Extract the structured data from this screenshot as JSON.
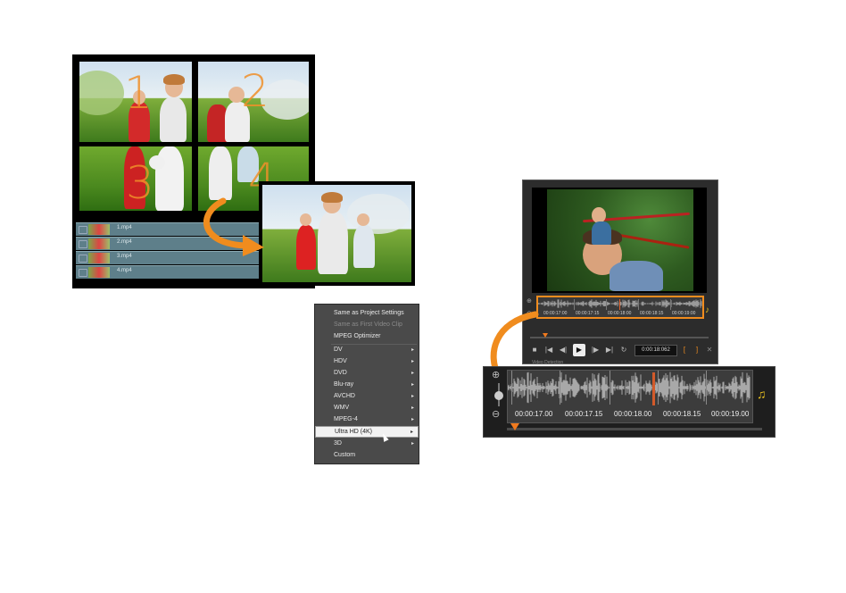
{
  "collage": {
    "quadrant_numbers": [
      "1",
      "2",
      "3",
      "4"
    ],
    "tracks": [
      {
        "name": "1.mp4"
      },
      {
        "name": "2.mp4"
      },
      {
        "name": "3.mp4"
      },
      {
        "name": "4.mp4"
      }
    ]
  },
  "format_menu": {
    "items": [
      {
        "label": "Same as Project Settings",
        "submenu": false,
        "disabled": false
      },
      {
        "label": "Same as First Video Clip",
        "submenu": false,
        "disabled": true
      },
      {
        "label": "MPEG Optimizer",
        "submenu": false,
        "disabled": false
      },
      {
        "label": "DV",
        "submenu": true,
        "disabled": false
      },
      {
        "label": "HDV",
        "submenu": true,
        "disabled": false
      },
      {
        "label": "DVD",
        "submenu": true,
        "disabled": false
      },
      {
        "label": "Blu-ray",
        "submenu": true,
        "disabled": false
      },
      {
        "label": "AVCHD",
        "submenu": true,
        "disabled": false
      },
      {
        "label": "WMV",
        "submenu": true,
        "disabled": false
      },
      {
        "label": "MPEG-4",
        "submenu": true,
        "disabled": false
      },
      {
        "label": "Ultra HD (4K)",
        "submenu": true,
        "disabled": false,
        "highlighted": true
      },
      {
        "label": "3D",
        "submenu": true,
        "disabled": false
      },
      {
        "label": "Custom",
        "submenu": false,
        "disabled": false
      }
    ]
  },
  "player": {
    "mini_timecodes": [
      "00:00:17:00",
      "00:00:17:15",
      "00:00:18:00",
      "00:00:18:15",
      "00:00:19:00"
    ],
    "timecode": "0:00:18:062",
    "section_label": "Video Detection"
  },
  "waveform": {
    "timecodes": [
      "00:00:17.00",
      "00:00:17.15",
      "00:00:18.00",
      "00:00:18.15",
      "00:00:19.00"
    ]
  },
  "colors": {
    "accent_orange": "#f08c1e",
    "playhead": "#d25a2a",
    "panel_dark": "#2c2c2c"
  },
  "icons": [
    "zoom-in-icon",
    "zoom-out-icon",
    "music-note-icon",
    "play-icon",
    "stop-icon",
    "repeat-icon"
  ]
}
